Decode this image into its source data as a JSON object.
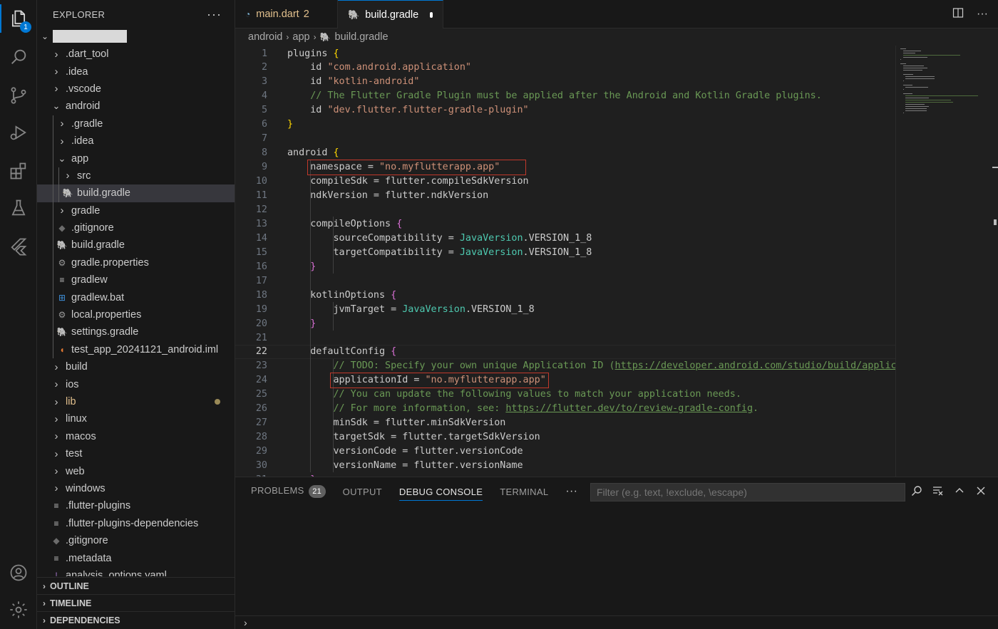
{
  "sidebar": {
    "title": "EXPLORER",
    "more": "···",
    "tree": [
      {
        "label": ".dart_tool",
        "depth": 1,
        "type": "folder",
        "open": false
      },
      {
        "label": ".idea",
        "depth": 1,
        "type": "folder",
        "open": false
      },
      {
        "label": ".vscode",
        "depth": 1,
        "type": "folder",
        "open": false
      },
      {
        "label": "android",
        "depth": 1,
        "type": "folder",
        "open": true
      },
      {
        "label": ".gradle",
        "depth": 2,
        "type": "folder",
        "open": false
      },
      {
        "label": ".idea",
        "depth": 2,
        "type": "folder",
        "open": false
      },
      {
        "label": "app",
        "depth": 2,
        "type": "folder",
        "open": true
      },
      {
        "label": "src",
        "depth": 3,
        "type": "folder",
        "open": false
      },
      {
        "label": "build.gradle",
        "depth": 3,
        "type": "gradle",
        "selected": true
      },
      {
        "label": "gradle",
        "depth": 2,
        "type": "folder",
        "open": false
      },
      {
        "label": ".gitignore",
        "depth": 2,
        "type": "git"
      },
      {
        "label": "build.gradle",
        "depth": 2,
        "type": "gradle"
      },
      {
        "label": "gradle.properties",
        "depth": 2,
        "type": "gear"
      },
      {
        "label": "gradlew",
        "depth": 2,
        "type": "lines"
      },
      {
        "label": "gradlew.bat",
        "depth": 2,
        "type": "windows"
      },
      {
        "label": "local.properties",
        "depth": 2,
        "type": "gear"
      },
      {
        "label": "settings.gradle",
        "depth": 2,
        "type": "gradle"
      },
      {
        "label": "test_app_20241121_android.iml",
        "depth": 2,
        "type": "rss"
      },
      {
        "label": "build",
        "depth": 1,
        "type": "folder",
        "open": false
      },
      {
        "label": "ios",
        "depth": 1,
        "type": "folder",
        "open": false
      },
      {
        "label": "lib",
        "depth": 1,
        "type": "folder",
        "open": false,
        "modified": true
      },
      {
        "label": "linux",
        "depth": 1,
        "type": "folder",
        "open": false
      },
      {
        "label": "macos",
        "depth": 1,
        "type": "folder",
        "open": false
      },
      {
        "label": "test",
        "depth": 1,
        "type": "folder",
        "open": false
      },
      {
        "label": "web",
        "depth": 1,
        "type": "folder",
        "open": false
      },
      {
        "label": "windows",
        "depth": 1,
        "type": "folder",
        "open": false
      },
      {
        "label": ".flutter-plugins",
        "depth": 1,
        "type": "lines"
      },
      {
        "label": ".flutter-plugins-dependencies",
        "depth": 1,
        "type": "lines"
      },
      {
        "label": ".gitignore",
        "depth": 1,
        "type": "git"
      },
      {
        "label": ".metadata",
        "depth": 1,
        "type": "lines"
      },
      {
        "label": "analysis_options.yaml",
        "depth": 1,
        "type": "yaml"
      }
    ],
    "sections": [
      "OUTLINE",
      "TIMELINE",
      "DEPENDENCIES"
    ]
  },
  "activity": {
    "explorer_badge": "1"
  },
  "tabs": [
    {
      "label": "main.dart",
      "problems": "2",
      "active": false
    },
    {
      "label": "build.gradle",
      "active": true,
      "dirty": true
    }
  ],
  "breadcrumb": [
    "android",
    "app",
    "build.gradle"
  ],
  "editor": {
    "current_line": 22,
    "lines": [
      {
        "n": "1",
        "html": "plugins <span class='b1'>{</span>"
      },
      {
        "n": "2",
        "html": "    id <span class='s'>\"com.android.application\"</span>"
      },
      {
        "n": "3",
        "html": "    id <span class='s'>\"kotlin-android\"</span>"
      },
      {
        "n": "4",
        "html": "    <span class='c'>// The Flutter Gradle Plugin must be applied after the Android and Kotlin Gradle plugins.</span>"
      },
      {
        "n": "5",
        "html": "    id <span class='s'>\"dev.flutter.flutter-gradle-plugin\"</span>"
      },
      {
        "n": "6",
        "html": "<span class='b1'>}</span>"
      },
      {
        "n": "7",
        "html": ""
      },
      {
        "n": "8",
        "html": "android <span class='b1'>{</span>"
      },
      {
        "n": "9",
        "html": "    namespace = <span class='s'>\"no.myflutterapp.app\"</span>"
      },
      {
        "n": "10",
        "html": "    compileSdk = flutter.compileSdkVersion"
      },
      {
        "n": "11",
        "html": "    ndkVersion = flutter.ndkVersion"
      },
      {
        "n": "12",
        "html": ""
      },
      {
        "n": "13",
        "html": "    compileOptions <span class='b2'>{</span>"
      },
      {
        "n": "14",
        "html": "        sourceCompatibility = <span class='t'>JavaVersion</span>.VERSION_1_8"
      },
      {
        "n": "15",
        "html": "        targetCompatibility = <span class='t'>JavaVersion</span>.VERSION_1_8"
      },
      {
        "n": "16",
        "html": "    <span class='b2'>}</span>"
      },
      {
        "n": "17",
        "html": ""
      },
      {
        "n": "18",
        "html": "    kotlinOptions <span class='b2'>{</span>"
      },
      {
        "n": "19",
        "html": "        jvmTarget = <span class='t'>JavaVersion</span>.VERSION_1_8"
      },
      {
        "n": "20",
        "html": "    <span class='b2'>}</span>"
      },
      {
        "n": "21",
        "html": ""
      },
      {
        "n": "22",
        "html": "    defaultConfig <span class='b2'>{</span>"
      },
      {
        "n": "23",
        "html": "        <span class='c'>// TODO: Specify your own unique Application ID (<span class='u'>https://developer.android.com/studio/build/application-id.html</span>).</span>"
      },
      {
        "n": "24",
        "html": "        applicationId = <span class='s'>\"no.myflutterapp.app\"</span>"
      },
      {
        "n": "25",
        "html": "        <span class='c'>// You can update the following values to match your application needs.</span>"
      },
      {
        "n": "26",
        "html": "        <span class='c'>// For more information, see: <span class='u'>https://flutter.dev/to/review-gradle-config</span>.</span>"
      },
      {
        "n": "27",
        "html": "        minSdk = flutter.minSdkVersion"
      },
      {
        "n": "28",
        "html": "        targetSdk = flutter.targetSdkVersion"
      },
      {
        "n": "29",
        "html": "        versionCode = flutter.versionCode"
      },
      {
        "n": "30",
        "html": "        versionName = flutter.versionName"
      },
      {
        "n": "31",
        "html": "    <span class='b2'>}</span>"
      }
    ]
  },
  "panel": {
    "tabs": [
      {
        "label": "PROBLEMS",
        "badge": "21"
      },
      {
        "label": "OUTPUT"
      },
      {
        "label": "DEBUG CONSOLE",
        "active": true
      },
      {
        "label": "TERMINAL"
      }
    ],
    "more": "···",
    "filter_placeholder": "Filter (e.g. text, !exclude, \\escape)",
    "prompt": "›"
  },
  "colors": {
    "accent": "#0078d4",
    "highlight_box": "#c0392b"
  }
}
